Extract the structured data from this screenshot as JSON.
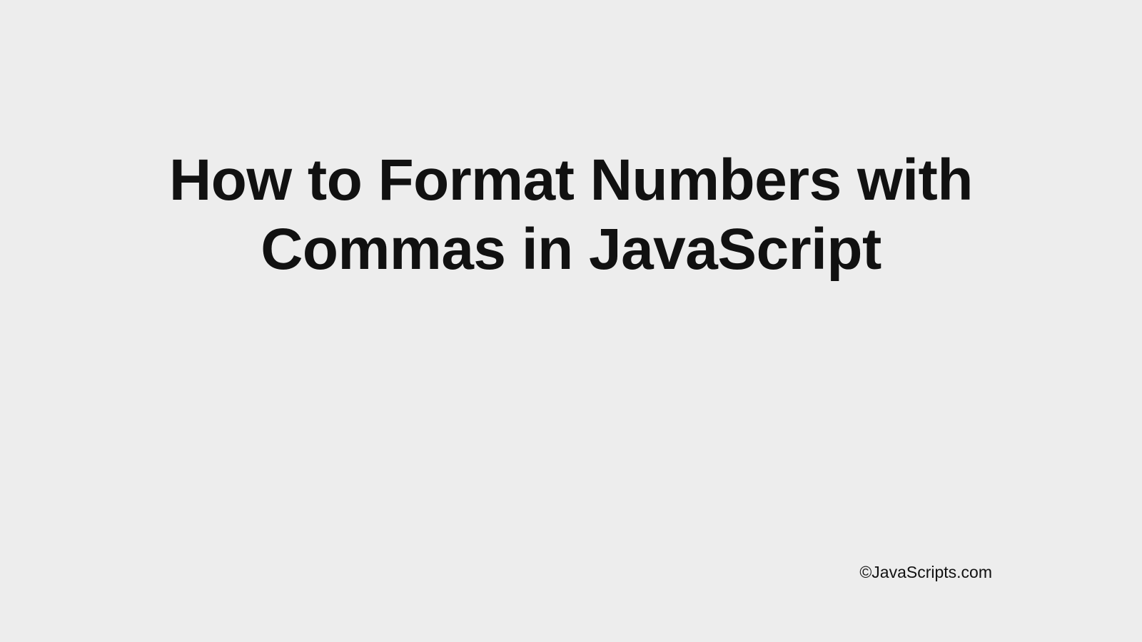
{
  "heading": "How to Format Numbers with Commas in JavaScript",
  "attribution": "©JavaScripts.com"
}
